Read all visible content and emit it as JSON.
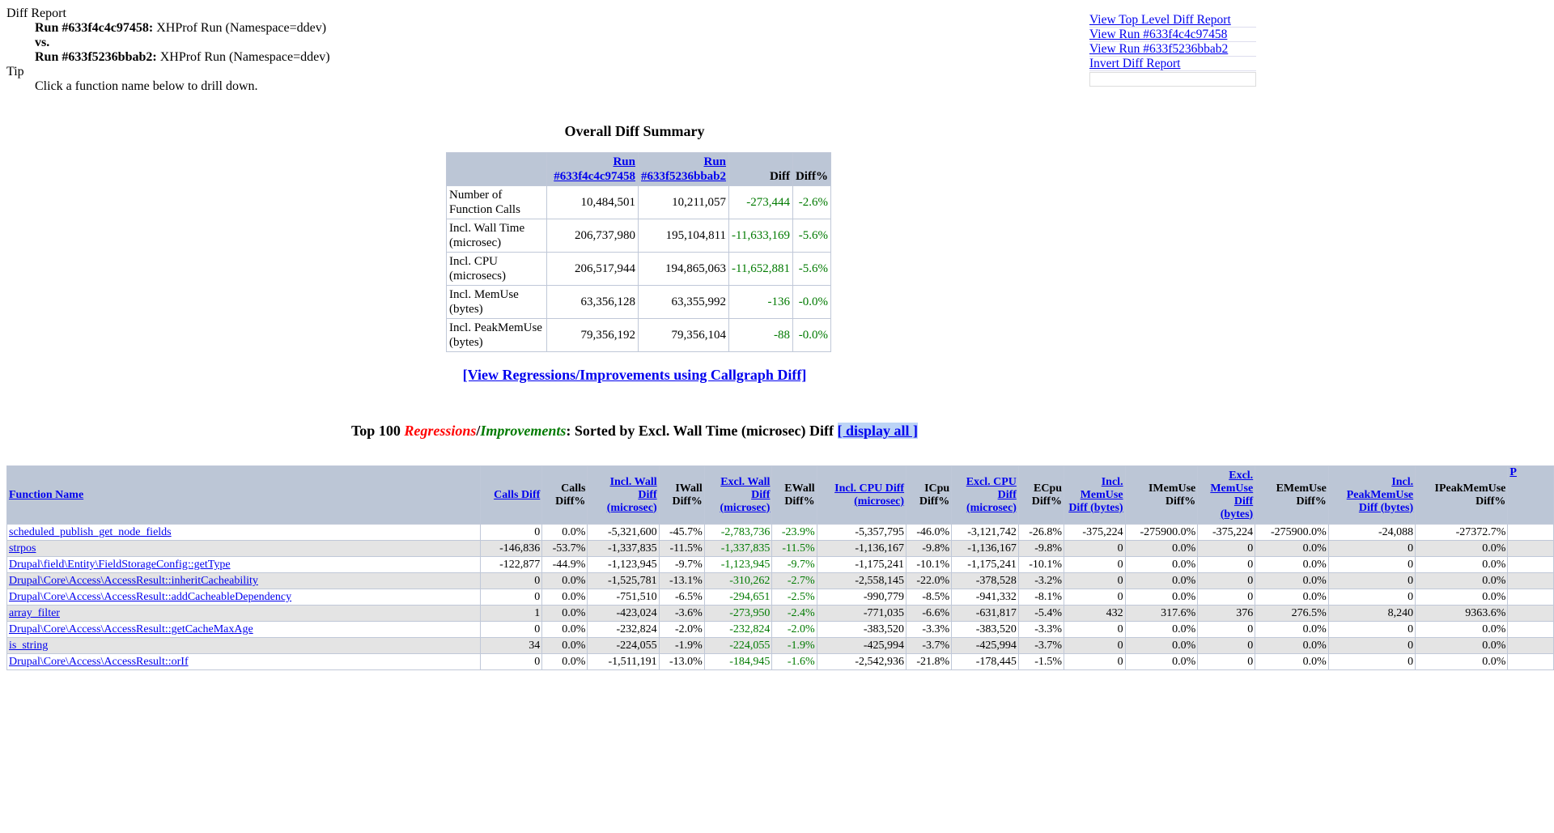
{
  "header": {
    "title": "Diff Report",
    "run1_label": "Run #633f4c4c97458:",
    "run1_desc": " XHProf Run (Namespace=ddev)",
    "vs": "vs.",
    "run2_label": "Run #633f5236bbab2:",
    "run2_desc": " XHProf Run (Namespace=ddev)",
    "tip_title": "Tip",
    "tip_text": "Click a function name below to drill down."
  },
  "links": [
    "View Top Level Diff Report",
    "View Run #633f4c4c97458",
    "View Run #633f5236bbab2",
    "Invert Diff Report"
  ],
  "summary": {
    "title": "Overall Diff Summary",
    "headers": [
      "",
      "Run #633f4c4c97458",
      "Run #633f5236bbab2",
      "Diff",
      "Diff%"
    ],
    "rows": [
      {
        "label": "Number of Function Calls",
        "run1": "10,484,501",
        "run2": "10,211,057",
        "diff": "-273,444",
        "pct": "-2.6%"
      },
      {
        "label": "Incl. Wall Time (microsec)",
        "run1": "206,737,980",
        "run2": "195,104,811",
        "diff": "-11,633,169",
        "pct": "-5.6%"
      },
      {
        "label": "Incl. CPU (microsecs)",
        "run1": "206,517,944",
        "run2": "194,865,063",
        "diff": "-11,652,881",
        "pct": "-5.6%"
      },
      {
        "label": "Incl. MemUse (bytes)",
        "run1": "63,356,128",
        "run2": "63,355,992",
        "diff": "-136",
        "pct": "-0.0%"
      },
      {
        "label": "Incl. PeakMemUse (bytes)",
        "run1": "79,356,192",
        "run2": "79,356,104",
        "diff": "-88",
        "pct": "-0.0%"
      }
    ]
  },
  "callgraph_link": "[View Regressions/Improvements using Callgraph Diff]",
  "top": {
    "prefix": "Top 100 ",
    "regressions": "Regressions",
    "slash": "/",
    "improvements": "Improvements",
    "suffix": ": Sorted by Excl. Wall Time (microsec) Diff ",
    "display_all": "[ display all ]"
  },
  "colors": {
    "improvement": "#007a00",
    "regression": "#ff0000",
    "header_bg": "#bcc6d6",
    "link": "#0000ee"
  },
  "table": {
    "columns": [
      {
        "label": "Function Name",
        "link": true
      },
      {
        "label": "Calls Diff",
        "link": true
      },
      {
        "label": "Calls Diff%",
        "link": false
      },
      {
        "label": "Incl. Wall Diff (microsec)",
        "link": true
      },
      {
        "label": "IWall Diff%",
        "link": false
      },
      {
        "label": "Excl. Wall Diff (microsec)",
        "link": true
      },
      {
        "label": "EWall Diff%",
        "link": false
      },
      {
        "label": "Incl. CPU Diff (microsec)",
        "link": true
      },
      {
        "label": "ICpu Diff%",
        "link": false
      },
      {
        "label": "Excl. CPU Diff (microsec)",
        "link": true
      },
      {
        "label": "ECpu Diff%",
        "link": false
      },
      {
        "label": "Incl. MemUse Diff (bytes)",
        "link": true
      },
      {
        "label": "IMemUse Diff%",
        "link": false
      },
      {
        "label": "Excl. MemUse Diff (bytes)",
        "link": true
      },
      {
        "label": "EMemUse Diff%",
        "link": false
      },
      {
        "label": "Incl. PeakMemUse Diff (bytes)",
        "link": true
      },
      {
        "label": "IPeakMemUse Diff%",
        "link": false
      },
      {
        "label": "P",
        "link": true
      }
    ],
    "rows": [
      [
        "scheduled_publish_get_node_fields",
        "0",
        "0.0%",
        "-5,321,600",
        "-45.7%",
        "-2,783,736",
        "-23.9%",
        "-5,357,795",
        "-46.0%",
        "-3,121,742",
        "-26.8%",
        "-375,224",
        "-275900.0%",
        "-375,224",
        "-275900.0%",
        "-24,088",
        "-27372.7%"
      ],
      [
        "strpos",
        "-146,836",
        "-53.7%",
        "-1,337,835",
        "-11.5%",
        "-1,337,835",
        "-11.5%",
        "-1,136,167",
        "-9.8%",
        "-1,136,167",
        "-9.8%",
        "0",
        "0.0%",
        "0",
        "0.0%",
        "0",
        "0.0%"
      ],
      [
        "Drupal\\field\\Entity\\FieldStorageConfig::getType",
        "-122,877",
        "-44.9%",
        "-1,123,945",
        "-9.7%",
        "-1,123,945",
        "-9.7%",
        "-1,175,241",
        "-10.1%",
        "-1,175,241",
        "-10.1%",
        "0",
        "0.0%",
        "0",
        "0.0%",
        "0",
        "0.0%"
      ],
      [
        "Drupal\\Core\\Access\\AccessResult::inheritCacheability",
        "0",
        "0.0%",
        "-1,525,781",
        "-13.1%",
        "-310,262",
        "-2.7%",
        "-2,558,145",
        "-22.0%",
        "-378,528",
        "-3.2%",
        "0",
        "0.0%",
        "0",
        "0.0%",
        "0",
        "0.0%"
      ],
      [
        "Drupal\\Core\\Access\\AccessResult::addCacheableDependency",
        "0",
        "0.0%",
        "-751,510",
        "-6.5%",
        "-294,651",
        "-2.5%",
        "-990,779",
        "-8.5%",
        "-941,332",
        "-8.1%",
        "0",
        "0.0%",
        "0",
        "0.0%",
        "0",
        "0.0%"
      ],
      [
        "array_filter",
        "1",
        "0.0%",
        "-423,024",
        "-3.6%",
        "-273,950",
        "-2.4%",
        "-771,035",
        "-6.6%",
        "-631,817",
        "-5.4%",
        "432",
        "317.6%",
        "376",
        "276.5%",
        "8,240",
        "9363.6%"
      ],
      [
        "Drupal\\Core\\Access\\AccessResult::getCacheMaxAge",
        "0",
        "0.0%",
        "-232,824",
        "-2.0%",
        "-232,824",
        "-2.0%",
        "-383,520",
        "-3.3%",
        "-383,520",
        "-3.3%",
        "0",
        "0.0%",
        "0",
        "0.0%",
        "0",
        "0.0%"
      ],
      [
        "is_string",
        "34",
        "0.0%",
        "-224,055",
        "-1.9%",
        "-224,055",
        "-1.9%",
        "-425,994",
        "-3.7%",
        "-425,994",
        "-3.7%",
        "0",
        "0.0%",
        "0",
        "0.0%",
        "0",
        "0.0%"
      ],
      [
        "Drupal\\Core\\Access\\AccessResult::orIf",
        "0",
        "0.0%",
        "-1,511,191",
        "-13.0%",
        "-184,945",
        "-1.6%",
        "-2,542,936",
        "-21.8%",
        "-178,445",
        "-1.5%",
        "0",
        "0.0%",
        "0",
        "0.0%",
        "0",
        "0.0%"
      ]
    ]
  }
}
